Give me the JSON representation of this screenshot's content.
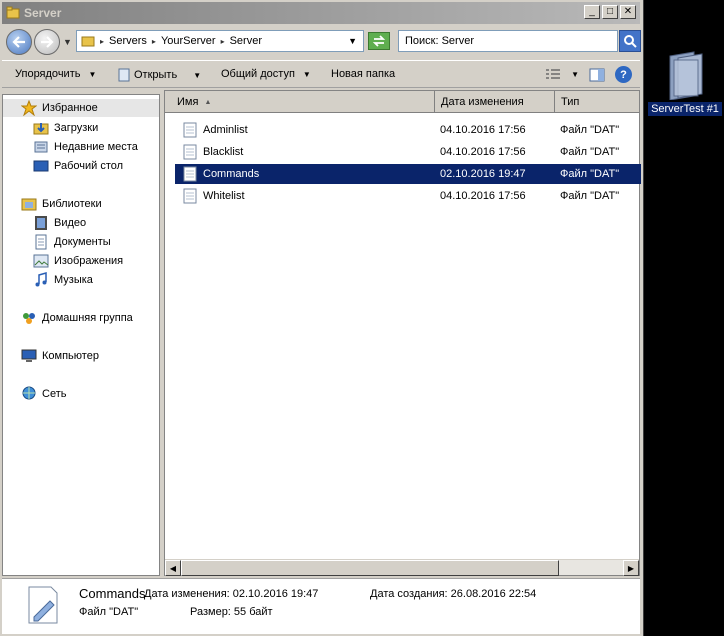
{
  "window": {
    "title": "Server",
    "minimize_glyph": "_",
    "maximize_glyph": "□",
    "close_glyph": "✕"
  },
  "address": {
    "crumbs": [
      "Servers",
      "YourServer",
      "Server"
    ],
    "search_text": "Поиск: Server"
  },
  "toolbar": {
    "organize": "Упорядочить",
    "open": "Открыть",
    "share": "Общий доступ",
    "new_folder": "Новая папка"
  },
  "nav": {
    "favorites": "Избранное",
    "downloads": "Загрузки",
    "recent": "Недавние места",
    "desktop": "Рабочий стол",
    "libraries": "Библиотеки",
    "video": "Видео",
    "documents": "Документы",
    "images": "Изображения",
    "music": "Музыка",
    "homegroup": "Домашняя группа",
    "computer": "Компьютер",
    "network": "Сеть"
  },
  "columns": {
    "name": "Имя",
    "date": "Дата изменения",
    "type": "Тип"
  },
  "files": [
    {
      "name": "Adminlist",
      "date": "04.10.2016 17:56",
      "type": "Файл \"DAT\""
    },
    {
      "name": "Blacklist",
      "date": "04.10.2016 17:56",
      "type": "Файл \"DAT\""
    },
    {
      "name": "Commands",
      "date": "02.10.2016 19:47",
      "type": "Файл \"DAT\""
    },
    {
      "name": "Whitelist",
      "date": "04.10.2016 17:56",
      "type": "Файл \"DAT\""
    }
  ],
  "details": {
    "name": "Commands",
    "modified": "Дата изменения: 02.10.2016 19:47",
    "created": "Дата создания: 26.08.2016 22:54",
    "type": "Файл \"DAT\"",
    "size": "Размер: 55 байт"
  },
  "desktop": {
    "icon_label": "ServerTest #1"
  }
}
